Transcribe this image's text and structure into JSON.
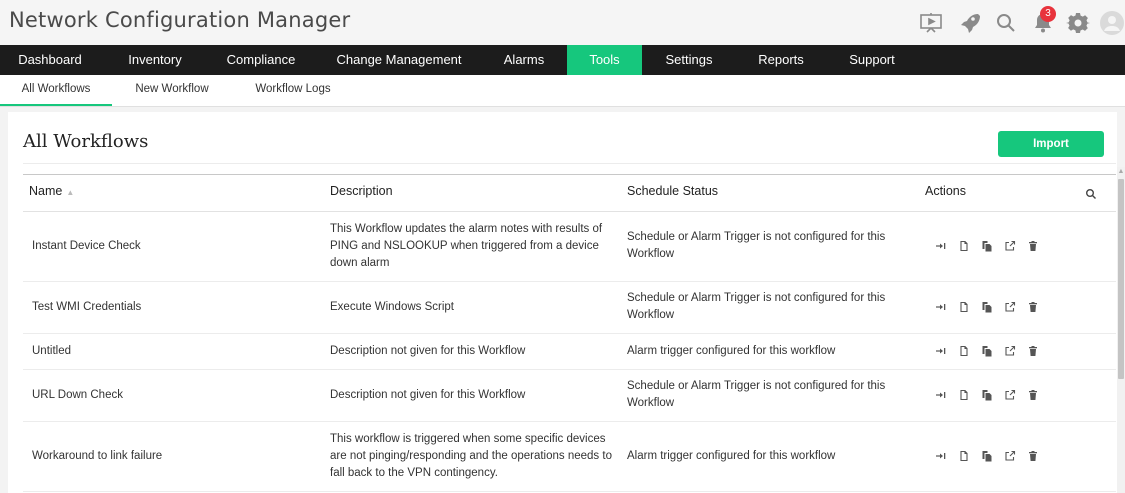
{
  "app": {
    "title": "Network Configuration Manager",
    "notification_count": "3"
  },
  "nav": {
    "items": [
      {
        "label": "Dashboard"
      },
      {
        "label": "Inventory"
      },
      {
        "label": "Compliance"
      },
      {
        "label": "Change Management"
      },
      {
        "label": "Alarms"
      },
      {
        "label": "Tools",
        "active": true
      },
      {
        "label": "Settings"
      },
      {
        "label": "Reports"
      },
      {
        "label": "Support"
      }
    ]
  },
  "subnav": {
    "items": [
      {
        "label": "All Workflows",
        "active": true
      },
      {
        "label": "New Workflow"
      },
      {
        "label": "Workflow Logs"
      }
    ]
  },
  "page": {
    "title": "All Workflows",
    "import_label": "Import"
  },
  "table": {
    "columns": [
      "Name",
      "Description",
      "Schedule Status",
      "Actions"
    ],
    "rows": [
      {
        "name": "Instant Device Check",
        "description": "This Workflow updates the alarm notes with results of PING and NSLOOKUP when triggered from a device down alarm",
        "status": "Schedule or Alarm Trigger is not configured for this Workflow"
      },
      {
        "name": "Test WMI Credentials",
        "description": "Execute Windows Script",
        "status": "Schedule or Alarm Trigger is not configured for this Workflow"
      },
      {
        "name": "Untitled",
        "description": "Description not given for this Workflow",
        "status": "Alarm trigger configured for this workflow"
      },
      {
        "name": "URL Down Check",
        "description": "Description not given for this Workflow",
        "status": "Schedule or Alarm Trigger is not configured for this Workflow"
      },
      {
        "name": "Workaround to link failure",
        "description": "This workflow is triggered when some specific devices are not pinging/responding and the operations needs to fall back to the VPN contingency.",
        "status": "Alarm trigger configured for this workflow"
      }
    ]
  },
  "colors": {
    "accent": "#16c77d",
    "nav_bg": "#1c1c1c",
    "badge": "#e8333c"
  },
  "icons": {
    "top": [
      "presentation-icon",
      "rocket-icon",
      "search-icon",
      "bell-icon",
      "gear-icon",
      "user-avatar-icon"
    ],
    "row_actions": [
      "execute-icon",
      "edit-icon",
      "copy-icon",
      "export-icon",
      "delete-icon"
    ]
  }
}
